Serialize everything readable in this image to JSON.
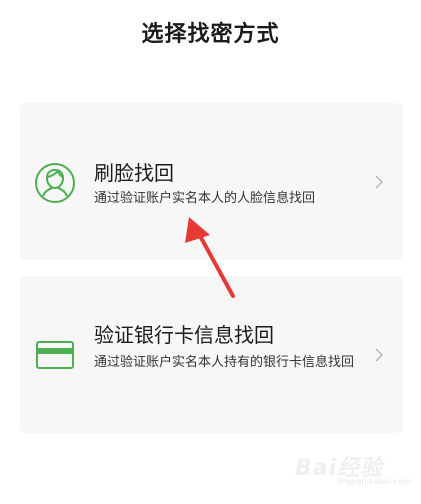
{
  "header": {
    "title": "选择找密方式"
  },
  "options": [
    {
      "title": "刷脸找回",
      "description": "通过验证账户实名本人的人脸信息找回",
      "icon": "face-recognition-icon"
    },
    {
      "title": "验证银行卡信息找回",
      "description": "通过验证账户实名本人持有的银行卡信息找回",
      "icon": "bank-card-icon"
    }
  ],
  "colors": {
    "accent_green": "#4caf50",
    "card_background": "#f7f7f7",
    "arrow_red": "#e53935"
  },
  "watermark": {
    "text": "Bai经验",
    "url": "jingyan.baidu.com"
  }
}
